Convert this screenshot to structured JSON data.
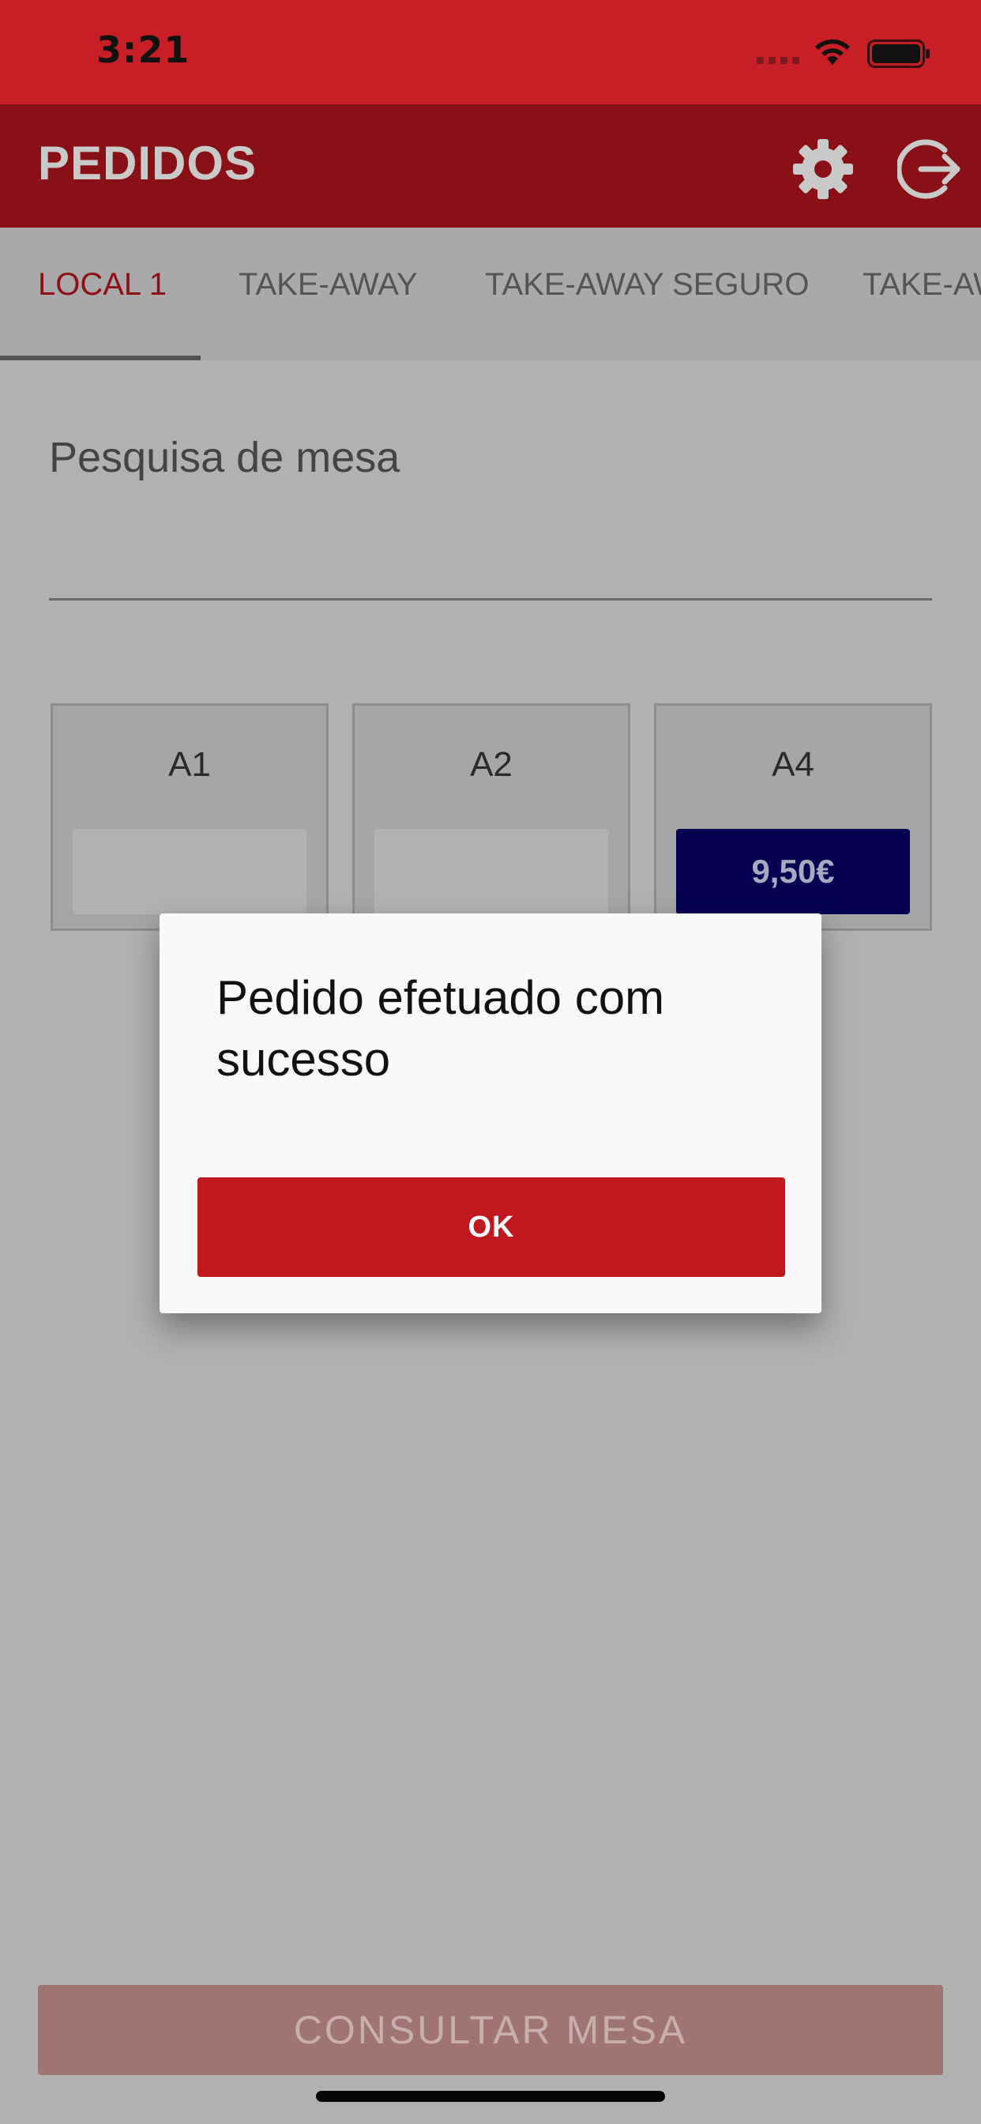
{
  "status_bar": {
    "time": "3:21",
    "icons": [
      "signal-icon",
      "wifi-icon",
      "battery-icon"
    ]
  },
  "header": {
    "title": "PEDIDOS",
    "icons": [
      "gear-icon",
      "logout-icon"
    ]
  },
  "tabs": [
    {
      "label": "LOCAL 1",
      "active": true
    },
    {
      "label": "TAKE-AWAY",
      "active": false
    },
    {
      "label": "TAKE-AWAY SEGURO",
      "active": false
    },
    {
      "label": "TAKE-AWAY",
      "active": false
    }
  ],
  "search": {
    "label": "Pesquisa de mesa",
    "value": ""
  },
  "tables": [
    {
      "name": "A1",
      "amount": ""
    },
    {
      "name": "A2",
      "amount": ""
    },
    {
      "name": "A4",
      "amount": "9,50€"
    }
  ],
  "dialog": {
    "message": "Pedido efetuado com sucesso",
    "ok_label": "OK"
  },
  "footer": {
    "consult_label": "CONSULTAR MESA"
  },
  "colors": {
    "status_bar": "#c81f26",
    "header": "#891016",
    "accent": "#c1181f",
    "amount_filled": "#070052"
  }
}
